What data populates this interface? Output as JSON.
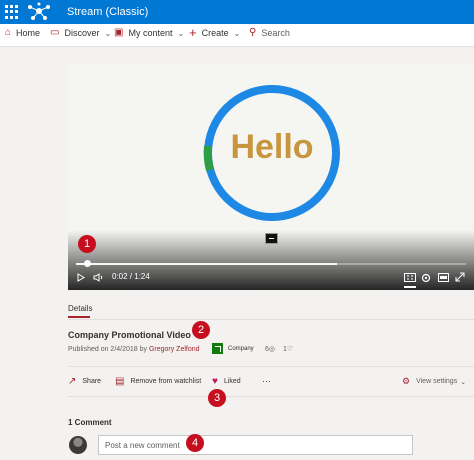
{
  "app": {
    "title": "Stream (Classic)"
  },
  "nav": {
    "home": "Home",
    "discover": "Discover",
    "my_content": "My content",
    "create": "Create",
    "search": "Search"
  },
  "player": {
    "video_text": "Hello",
    "time": "0:02 / 1:24",
    "progress_fraction": 0.025
  },
  "details": {
    "tab": "Details",
    "title": "Company Promotional Video",
    "published_prefix": "Published on 2/4/2018 by ",
    "author": "Gregory Zelfond",
    "company": "Company",
    "views": "6",
    "likes": "1"
  },
  "actions": {
    "share": "Share",
    "remove_watchlist": "Remove from watchlist",
    "liked": "Liked",
    "more": "···",
    "view_settings": "View settings"
  },
  "comments": {
    "count": "1 Comment",
    "placeholder": "Post a new comment"
  },
  "callouts": [
    "1",
    "2",
    "3",
    "4"
  ],
  "colors": {
    "brand": "#0078d4",
    "accent": "#a4262c",
    "callout": "#c50f1f",
    "ring": "#1e88e5",
    "ring_segment": "#2e9e44",
    "hello": "#c8963e"
  }
}
